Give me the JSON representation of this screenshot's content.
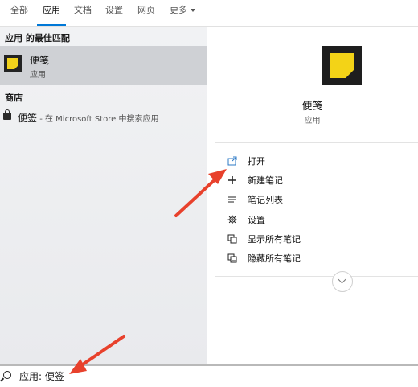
{
  "tabs": [
    {
      "label": "全部"
    },
    {
      "label": "应用"
    },
    {
      "label": "文档"
    },
    {
      "label": "设置"
    },
    {
      "label": "网页"
    },
    {
      "label": "更多"
    }
  ],
  "left": {
    "best_match_title": "应用 的最佳匹配",
    "best_match": {
      "name": "便笺",
      "type": "应用"
    },
    "store_title": "商店",
    "store_item": {
      "name": "便签",
      "suffix": " - 在 Microsoft Store 中搜索应用"
    }
  },
  "right": {
    "app_name": "便笺",
    "app_type": "应用",
    "actions": [
      {
        "label": "打开",
        "icon": "open-window-icon"
      },
      {
        "label": "新建笔记",
        "icon": "plus-icon"
      },
      {
        "label": "笔记列表",
        "icon": "list-icon"
      },
      {
        "label": "设置",
        "icon": "gear-icon"
      },
      {
        "label": "显示所有笔记",
        "icon": "show-notes-icon"
      },
      {
        "label": "隐藏所有笔记",
        "icon": "hide-notes-icon"
      }
    ]
  },
  "search": {
    "query": "应用: 便签"
  },
  "colors": {
    "accent": "#0078d7",
    "arrow": "#e8412c",
    "sticky_yellow": "#f3d317"
  }
}
